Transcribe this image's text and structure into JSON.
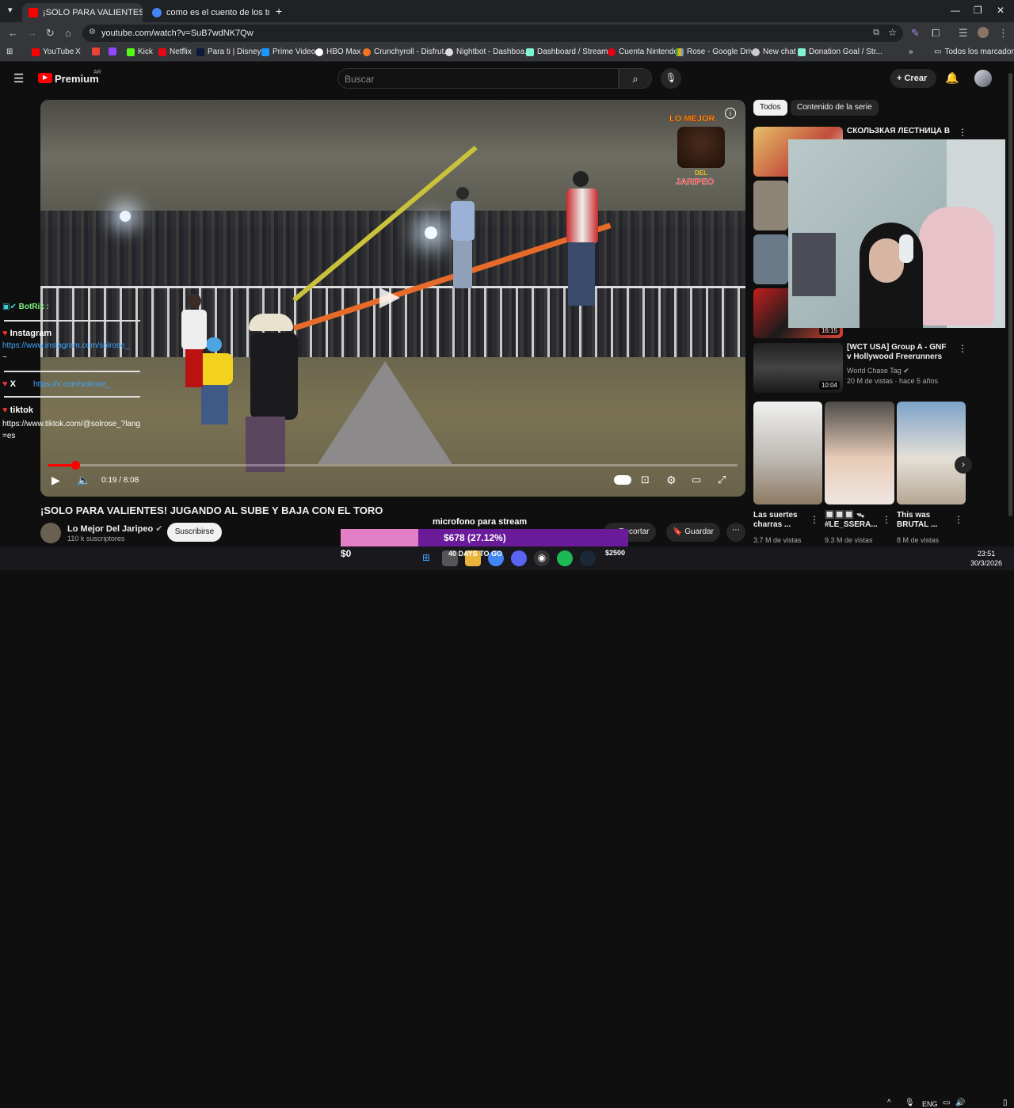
{
  "browser": {
    "tabs": [
      {
        "title": "¡SOLO PARA VALIENTES! JUGAN",
        "active": true
      },
      {
        "title": "como es el cuento de los tres c",
        "active": false
      }
    ],
    "url": "youtube.com/watch?v=SuB7wdNK7Qw",
    "bookmarks": [
      "YouTube",
      "X",
      "",
      "",
      "Kick",
      "Netflix",
      "Para ti | Disney+",
      "Prime Video",
      "HBO Max",
      "Crunchyroll - Disfrut...",
      "Nightbot - Dashboa...",
      "Dashboard / Stream...",
      "Cuenta Nintendo",
      "Rose - Google Drive",
      "New chat",
      "Donation Goal / Str..."
    ],
    "all_bookmarks": "Todos los marcadores"
  },
  "youtube": {
    "logo": "Premium",
    "region": "AR",
    "search_placeholder": "Buscar",
    "create_label": "Crear"
  },
  "video": {
    "title": "¡SOLO PARA VALIENTES! JUGANDO AL SUBE Y BAJA CON EL TORO",
    "time": "0:19 / 8:08",
    "progress": 0.039,
    "channel_logo_text": [
      "LO MEJOR",
      "DEL",
      "JARIPEO"
    ],
    "channel": "Lo Mejor Del Jaripeo",
    "subscribers": "110 k suscriptores",
    "subscribe_label": "Suscribirse",
    "clip_label": "Recortar",
    "save_label": "Guardar"
  },
  "chat": {
    "bot": "BotRix :",
    "lines": [
      {
        "label": "Instagram",
        "link": "https://www.instagram.com/solrose_"
      },
      {
        "label": "X",
        "link": "https://x.com/solrose_"
      },
      {
        "label": "tiktok",
        "link": "https://www.tiktok.com/@solrose_?lang=es"
      }
    ],
    "tilde": "~"
  },
  "donation": {
    "label": "microfono para stream",
    "raised": "$678 (27.12%)",
    "fraction": 0.2712,
    "start": "$0",
    "goal": "$2500",
    "days": "40 DAYS TO GO"
  },
  "sidebar": {
    "chips": [
      "Todos",
      "Contenido de la serie"
    ],
    "items": [
      {
        "title": "СКОЛЬЗКАЯ ЛЕСТНИЦА В",
        "meta": ""
      },
      {
        "title": "[WCT USA] Group A - GNF v Hollywood Freerunners",
        "channel": "World Chase Tag",
        "meta": "20 M de vistas · hace 5 años",
        "duration": "10:04"
      },
      {
        "duration": "16:15"
      }
    ],
    "shorts": [
      {
        "title": "Las suertes charras ...",
        "views": "3.7 M de vistas"
      },
      {
        "title": "🔲🔲🔲 ᯓ #LE_SSERA...",
        "views": "9.3 M de vistas"
      },
      {
        "title": "This was BRUTAL ...",
        "views": "8 M de vistas"
      }
    ]
  },
  "taskbar": {
    "lang": "ENG",
    "time": "23:51",
    "date": "30/3/2026"
  },
  "colors": {
    "accent": "#ff0000",
    "donation_fill": "#e27fc7",
    "donation_bg": "#6a1b9a"
  }
}
